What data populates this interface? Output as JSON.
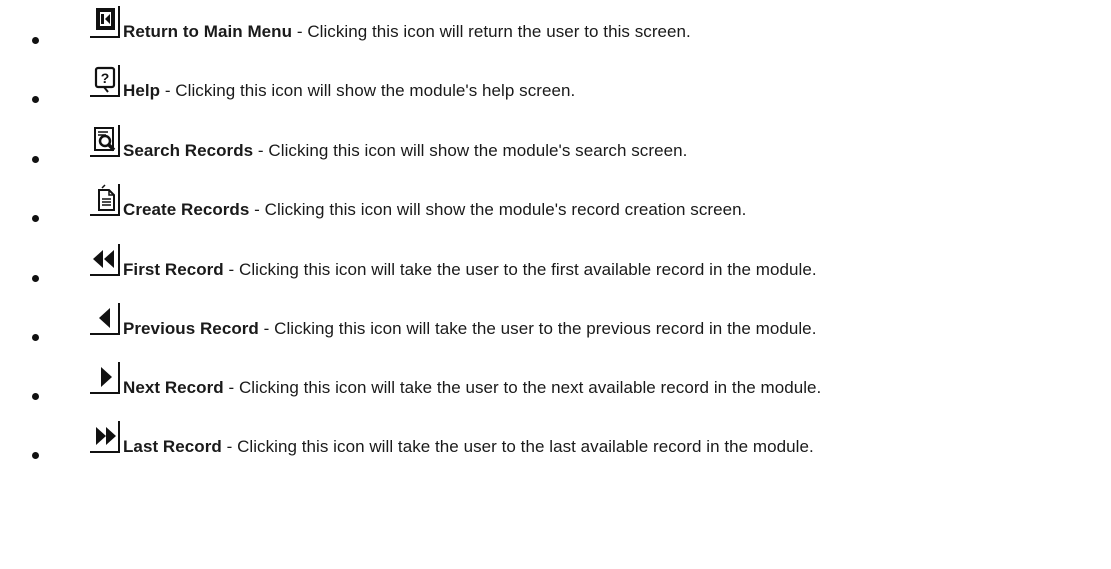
{
  "items": [
    {
      "icon": "return-to-main-menu-icon",
      "name": "Return to Main Menu",
      "description": " - Clicking this icon will return the user to this screen."
    },
    {
      "icon": "help-icon",
      "name": "Help",
      "description": " - Clicking this icon will show the module's help screen."
    },
    {
      "icon": "search-records-icon",
      "name": "Search Records",
      "description": " - Clicking this icon will show the module's search screen."
    },
    {
      "icon": "create-records-icon",
      "name": "Create Records",
      "description": " - Clicking this icon will show the module's record creation screen."
    },
    {
      "icon": "first-record-icon",
      "name": "First Record",
      "description": " - Clicking this icon will take the user to the first available record in the module."
    },
    {
      "icon": "previous-record-icon",
      "name": "Previous Record",
      "description": " - Clicking this icon will take the user to the previous record in the module."
    },
    {
      "icon": "next-record-icon",
      "name": "Next Record",
      "description": " - Clicking this icon will take the user to the next available record in the module."
    },
    {
      "icon": "last-record-icon",
      "name": "Last Record",
      "description": " - Clicking this icon will take the user to the last available record in the module."
    }
  ]
}
